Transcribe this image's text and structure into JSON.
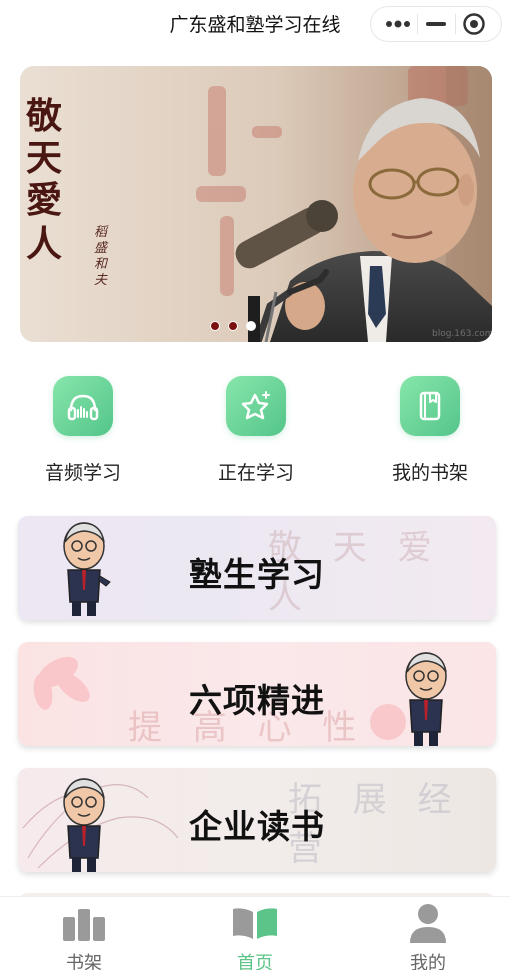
{
  "header": {
    "title": "广东盛和塾学习在线",
    "more_icon": "more-dots-icon",
    "minimize_icon": "minimize-icon",
    "close_icon": "target-circle-icon"
  },
  "banner": {
    "headline": "敬天愛人",
    "signature": "稻盛和夫",
    "watermark": "blog.163.com",
    "slides": 3,
    "active_slide": 3
  },
  "quick_menu": [
    {
      "label": "音频学习",
      "icon": "headphones-icon"
    },
    {
      "label": "正在学习",
      "icon": "star-icon"
    },
    {
      "label": "我的书架",
      "icon": "book-icon"
    }
  ],
  "cards": [
    {
      "title": "塾生学习",
      "deco": "敬 天 爱 人"
    },
    {
      "title": "六项精进",
      "deco": "提 高 心 性"
    },
    {
      "title": "企业读书",
      "deco": "拓 展 经 营"
    }
  ],
  "tabbar": {
    "items": [
      {
        "label": "书架",
        "icon": "bookshelf-icon",
        "active": false
      },
      {
        "label": "首页",
        "icon": "open-book-icon",
        "active": true
      },
      {
        "label": "我的",
        "icon": "user-icon",
        "active": false
      }
    ]
  },
  "colors": {
    "accent": "#5cc489",
    "quick_icon_gradient_start": "#87e6aa",
    "quick_icon_gradient_end": "#54c58a",
    "banner_dot": "#7a1010"
  }
}
